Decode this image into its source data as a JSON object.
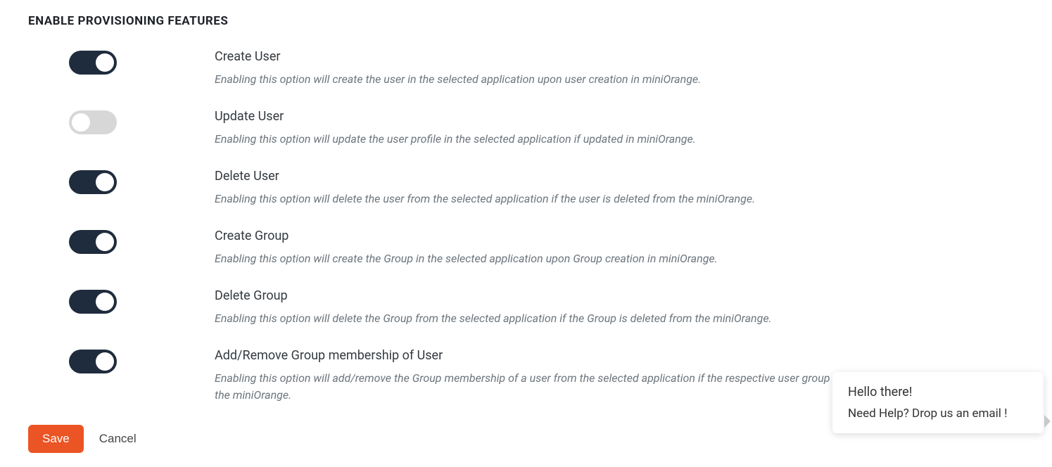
{
  "heading": "ENABLE PROVISIONING FEATURES",
  "features": [
    {
      "title": "Create User",
      "desc": "Enabling this option will create the user in the selected application upon user creation in miniOrange.",
      "on": true
    },
    {
      "title": "Update User",
      "desc": "Enabling this option will update the user profile in the selected application if updated in miniOrange.",
      "on": false
    },
    {
      "title": "Delete User",
      "desc": "Enabling this option will delete the user from the selected application if the user is deleted from the miniOrange.",
      "on": true
    },
    {
      "title": "Create Group",
      "desc": "Enabling this option will create the Group in the selected application upon Group creation in miniOrange.",
      "on": true
    },
    {
      "title": "Delete Group",
      "desc": "Enabling this option will delete the Group from the selected application if the Group is deleted from the miniOrange.",
      "on": true
    },
    {
      "title": "Add/Remove Group membership of User",
      "desc": "Enabling this option will add/remove the Group membership of a user from the selected application if the respective user group membership is updated from the miniOrange.",
      "on": true
    }
  ],
  "buttons": {
    "save": "Save",
    "cancel": "Cancel"
  },
  "help_popup": {
    "line1": "Hello there!",
    "line2": "Need Help? Drop us an email !"
  }
}
